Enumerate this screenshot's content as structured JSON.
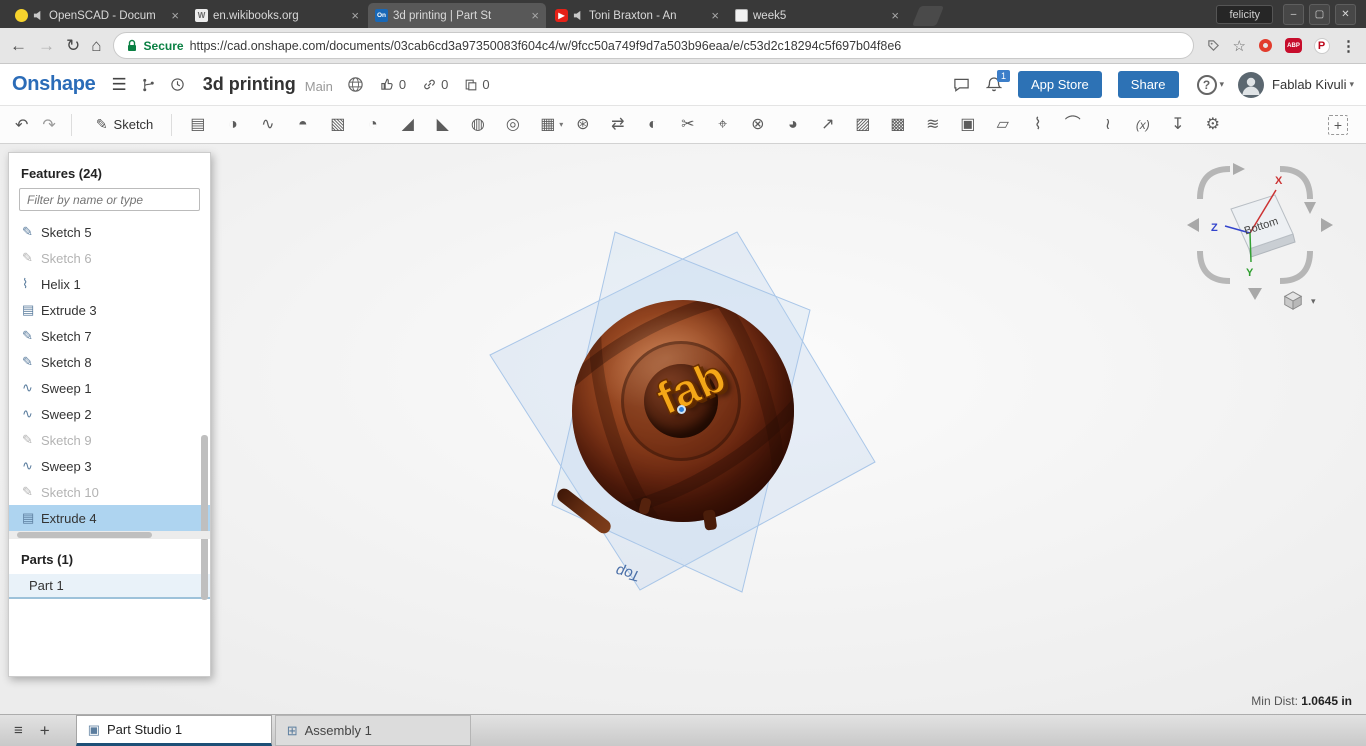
{
  "glyphs": {
    "caret": "▾",
    "close": "×",
    "star": "☆",
    "menu": "⋮",
    "back": "←",
    "forward": "→",
    "reload": "↻",
    "home": "⌂",
    "hamburger": "☰",
    "undo": "↶",
    "redo": "↷",
    "plus": "+",
    "minimize": "–",
    "maximize": "▢",
    "close_win": "✕",
    "pages": "≡",
    "pencil": "✎"
  },
  "window": {
    "profile_name": "felicity"
  },
  "browser": {
    "tabs": [
      {
        "title": "OpenSCAD - Docum"
      },
      {
        "title": "en.wikibooks.org",
        "favicon_text": "W"
      },
      {
        "title": "3d printing | Part St",
        "favicon_text": "On"
      },
      {
        "title": "Toni Braxton - An",
        "favicon_text": "▶"
      },
      {
        "title": "week5"
      }
    ],
    "security_label": "Secure",
    "url": "https://cad.onshape.com/documents/03cab6cd3a97350083f604c4/w/9fcc50a749f9d7a503b96eaa/e/c53d2c18294c5f697b04f8e6",
    "abp_label": "ABP",
    "pinterest_label": "P"
  },
  "header": {
    "logo": "Onshape",
    "doc_title": "3d printing",
    "workspace": "Main",
    "likes": "0",
    "links": "0",
    "copies": "0",
    "notifications": "1",
    "app_store": "App Store",
    "share": "Share",
    "help_glyph": "?",
    "user_name": "Fablab Kivuli"
  },
  "toolbar": {
    "sketch_label": "Sketch",
    "tools": [
      {
        "name": "extrude",
        "glyph": "▤"
      },
      {
        "name": "revolve",
        "glyph": "◑"
      },
      {
        "name": "sweep",
        "glyph": "∿"
      },
      {
        "name": "loft",
        "glyph": "◓"
      },
      {
        "name": "thicken",
        "glyph": "▧"
      },
      {
        "name": "fillet",
        "glyph": "◔"
      },
      {
        "name": "chamfer",
        "glyph": "◢"
      },
      {
        "name": "draft",
        "glyph": "◣"
      },
      {
        "name": "shell",
        "glyph": "◍"
      },
      {
        "name": "hole",
        "glyph": "◎"
      },
      {
        "name": "linear-pattern",
        "glyph": "▦"
      },
      {
        "name": "circular-pattern",
        "glyph": "⊛"
      },
      {
        "name": "mirror",
        "glyph": "⇄"
      },
      {
        "name": "boolean",
        "glyph": "◐"
      },
      {
        "name": "split",
        "glyph": "✂"
      },
      {
        "name": "transform",
        "glyph": "⌖"
      },
      {
        "name": "delete-part",
        "glyph": "⊗"
      },
      {
        "name": "modify-fillet",
        "glyph": "◕"
      },
      {
        "name": "move-face",
        "glyph": "↗"
      },
      {
        "name": "replace-face",
        "glyph": "▨"
      },
      {
        "name": "delete-face",
        "glyph": "▩"
      },
      {
        "name": "offset-surface",
        "glyph": "≋"
      },
      {
        "name": "fill",
        "glyph": "▣"
      },
      {
        "name": "plane",
        "glyph": "▱"
      },
      {
        "name": "helix",
        "glyph": "⌇"
      },
      {
        "name": "project-curve",
        "glyph": "⌒"
      },
      {
        "name": "composite-curve",
        "glyph": "≀"
      },
      {
        "name": "variable",
        "glyph": "(x)"
      },
      {
        "name": "import",
        "glyph": "↧"
      },
      {
        "name": "custom-feature",
        "glyph": "⚙"
      }
    ]
  },
  "features_panel": {
    "title": "Features (24)",
    "filter_placeholder": "Filter by name or type",
    "items": [
      {
        "label": "Sketch 5",
        "glyph": "✎",
        "suppressed": false
      },
      {
        "label": "Sketch 6",
        "glyph": "✎",
        "suppressed": true
      },
      {
        "label": "Helix 1",
        "glyph": "⌇",
        "suppressed": false
      },
      {
        "label": "Extrude 3",
        "glyph": "▤",
        "suppressed": false
      },
      {
        "label": "Sketch 7",
        "glyph": "✎",
        "suppressed": false
      },
      {
        "label": "Sketch 8",
        "glyph": "✎",
        "suppressed": false
      },
      {
        "label": "Sweep 1",
        "glyph": "∿",
        "suppressed": false
      },
      {
        "label": "Sweep 2",
        "glyph": "∿",
        "suppressed": false
      },
      {
        "label": "Sketch 9",
        "glyph": "✎",
        "suppressed": true
      },
      {
        "label": "Sweep 3",
        "glyph": "∿",
        "suppressed": false
      },
      {
        "label": "Sketch 10",
        "glyph": "✎",
        "suppressed": true
      },
      {
        "label": "Extrude 4",
        "glyph": "▤",
        "suppressed": false,
        "selected": true
      }
    ],
    "parts_title": "Parts (1)",
    "parts": [
      {
        "label": "Part 1"
      }
    ]
  },
  "viewport": {
    "plane_label": "Top",
    "cube_face_label": "Bottom",
    "axis_x": "X",
    "axis_y": "Y",
    "axis_z": "Z",
    "model_text": "fab",
    "min_dist_label": "Min Dist:",
    "min_dist_value": "1.0645 in"
  },
  "bottom_bar": {
    "tabs": [
      {
        "label": "Part Studio 1",
        "glyph": "▣"
      },
      {
        "label": "Assembly 1",
        "glyph": "⊞"
      }
    ]
  }
}
